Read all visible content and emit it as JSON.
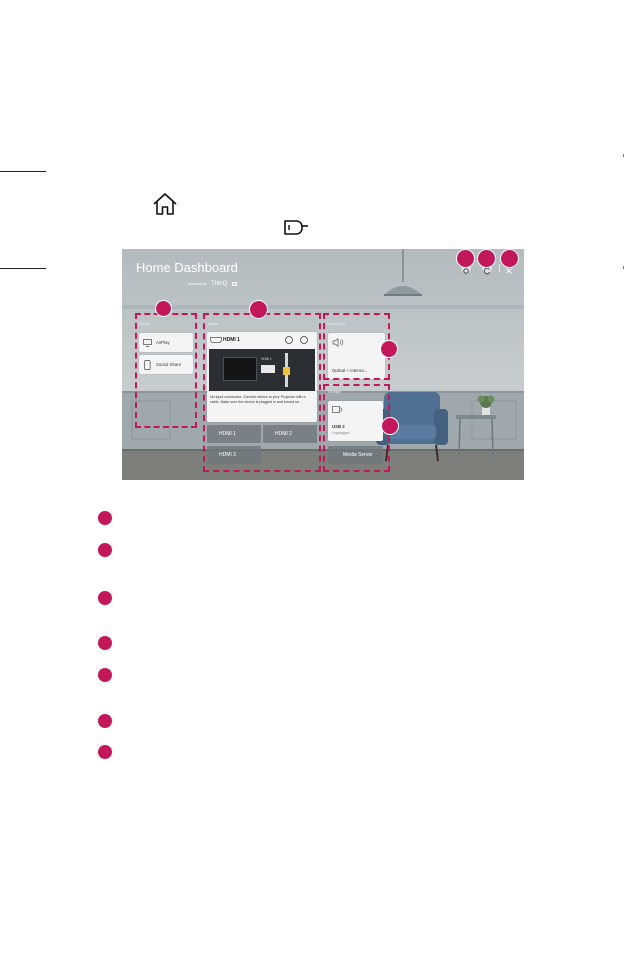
{
  "screen": {
    "title": "Home Dashboard",
    "subtitle_prefix": "powered by",
    "subtitle_brand": "ThinQ",
    "subtitle_tag": "AI",
    "mobile": {
      "header": "Mobile",
      "items": [
        "AirPlay",
        "Sound Share"
      ]
    },
    "inputs": {
      "header": "Inputs",
      "active": "HDMI 1",
      "diagram_label": "HDMI 1",
      "message": "No input connected. Connect device to your Projector with a cable. Make sure the device is plugged in and turned on.",
      "ports": [
        "HDMI 1",
        "HDMI 2",
        "HDMI 3"
      ]
    },
    "sound_out": {
      "header": "Sound Out",
      "value": "Optical + Interna..."
    },
    "storage": {
      "header": "Storage",
      "usb_name": "USB 2",
      "usb_status": "Unplugged",
      "media_server": "Media Server"
    },
    "top_icons": [
      "gear-icon",
      "refresh-icon",
      "close-icon"
    ]
  },
  "colors": {
    "accent": "#c2185b",
    "wall": "#c1c8cb",
    "sofa": "#4f6f93",
    "floor": "#7d7f7b"
  },
  "icons": [
    "home-icon",
    "input-connector-icon"
  ],
  "callout_count": 7
}
